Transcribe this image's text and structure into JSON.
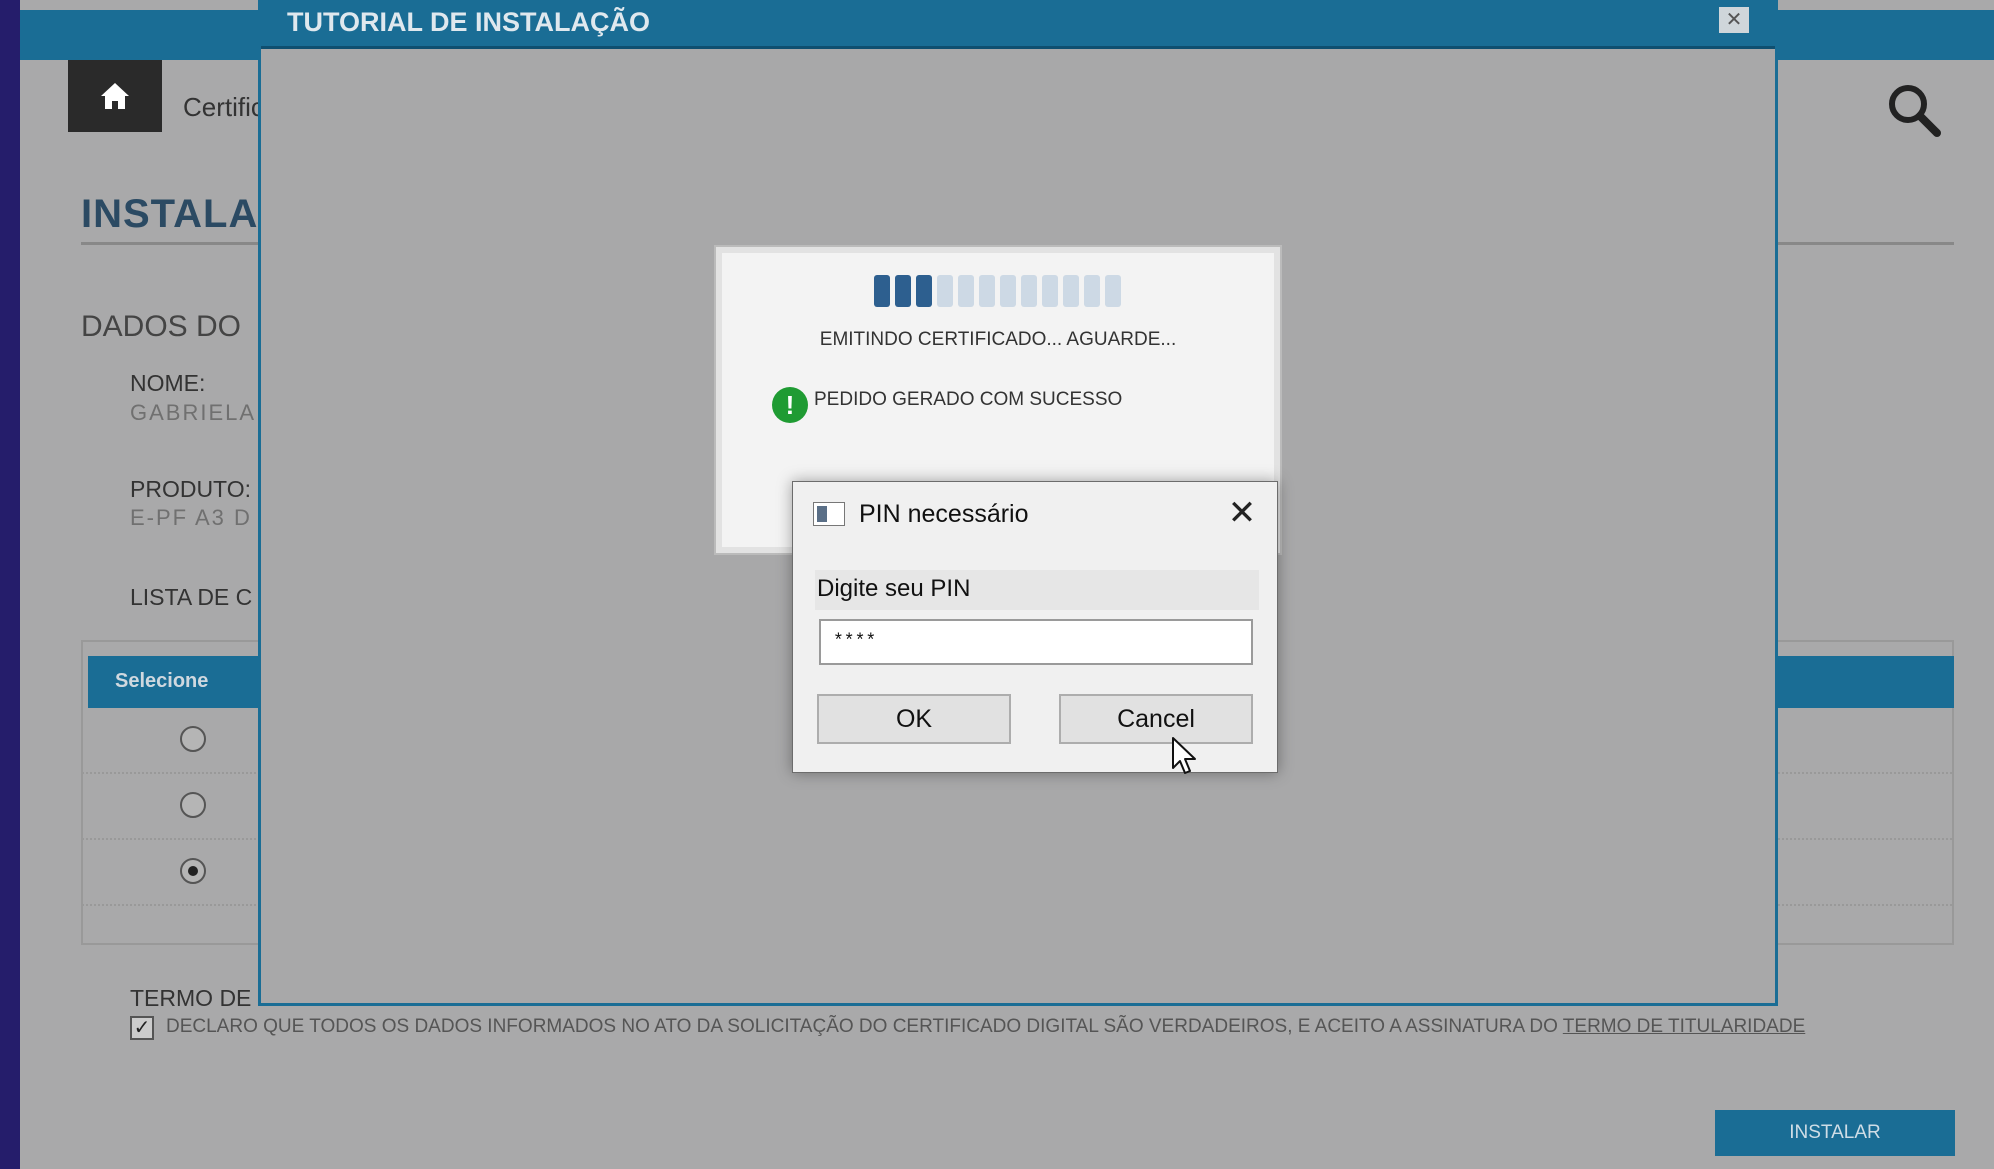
{
  "page": {
    "breadcrumb": "Certific",
    "title": "INSTALA",
    "section": "DADOS DO",
    "fields": [
      {
        "label": "NOME:",
        "value": "GABRIELA"
      },
      {
        "label": "PRODUTO:",
        "value": "E-PF A3 D"
      },
      {
        "label": "LISTA DE C",
        "value": ""
      }
    ],
    "table": {
      "header": "Selecione",
      "selected_row": 3,
      "rows": 3
    },
    "termo_label": "TERMO DE",
    "declaration": "DECLARO QUE TODOS OS DADOS INFORMADOS NO ATO DA SOLICITAÇÃO DO CERTIFICADO DIGITAL SÃO VERDADEIROS, E ACEITO A ASSINATURA DO ",
    "declaration_link": "TERMO DE TITULARIDADE",
    "declaration_checked": true,
    "install_button": "INSTALAR"
  },
  "tutorial": {
    "title": "TUTORIAL DE INSTALAÇÃO",
    "close": "✕"
  },
  "progress": {
    "segments_total": 12,
    "segments_on": 3,
    "status": "EMITINDO CERTIFICADO... AGUARDE...",
    "success_icon": "!",
    "success": "PEDIDO GERADO COM SUCESSO"
  },
  "pin_dialog": {
    "title": "PIN necessário",
    "close": "✕",
    "prompt": "Digite seu PIN",
    "value": "****",
    "ok": "OK",
    "cancel": "Cancel"
  },
  "colors": {
    "brand_blue": "#1a6d95",
    "success_green": "#1f9b33",
    "progress_on": "#2d5f8f"
  },
  "icons": {
    "home": "home-icon",
    "search": "search-icon",
    "dialog": "window-icon",
    "success": "exclamation-icon",
    "cursor": "mouse-pointer-icon"
  }
}
